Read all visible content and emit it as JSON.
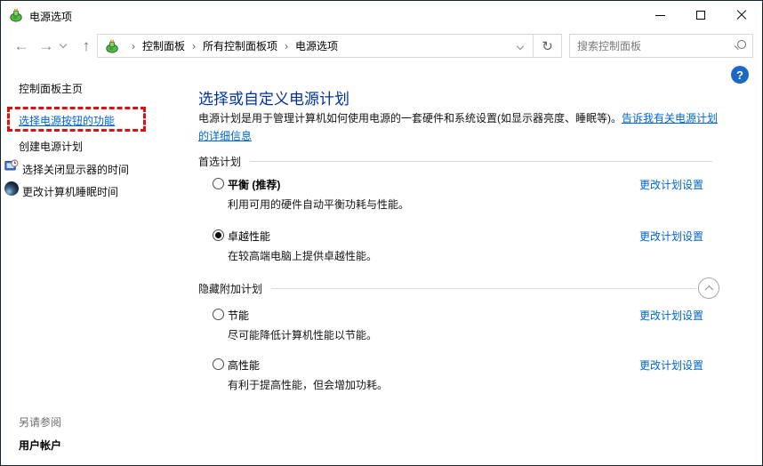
{
  "window": {
    "title": "电源选项"
  },
  "navbar": {
    "back_glyph": "←",
    "forward_glyph": "→",
    "up_glyph": "↑",
    "refresh_glyph": "↻",
    "separator": "›",
    "breadcrumb": [
      "控制面板",
      "所有控制面板项",
      "电源选项"
    ],
    "search_placeholder": "搜索控制面板"
  },
  "sidebar": {
    "home": "控制面板主页",
    "power_buttons_link": "选择电源按钮的功能",
    "create_plan": "创建电源计划",
    "display_off_time": "选择关闭显示器的时间",
    "sleep_time": "更改计算机睡眠时间",
    "see_also": "另请参阅",
    "user_accounts": "用户帐户"
  },
  "main": {
    "help_glyph": "?",
    "title": "选择或自定义电源计划",
    "description": "电源计划是用于管理计算机如何使用电源的一套硬件和系统设置(如显示器亮度、睡眠等)。",
    "learn_more": "告诉我有关电源计划的详细信息",
    "section_preferred": "首选计划",
    "section_hidden": "隐藏附加计划",
    "change_link": "更改计划设置",
    "plans": [
      {
        "name": "平衡 (推荐)",
        "selected": false,
        "desc": "利用可用的硬件自动平衡功耗与性能。"
      },
      {
        "name": "卓越性能",
        "selected": true,
        "desc": "在较高端电脑上提供卓越性能。"
      },
      {
        "name": "节能",
        "selected": false,
        "desc": "尽可能降低计算机性能以节能。"
      },
      {
        "name": "高性能",
        "selected": false,
        "desc": "有利于提高性能，但会增加功耗。"
      }
    ]
  },
  "colors": {
    "link": "#0066CC",
    "heading": "#003399",
    "highlight_red": "#E01010",
    "help_blue": "#1C68C5"
  }
}
